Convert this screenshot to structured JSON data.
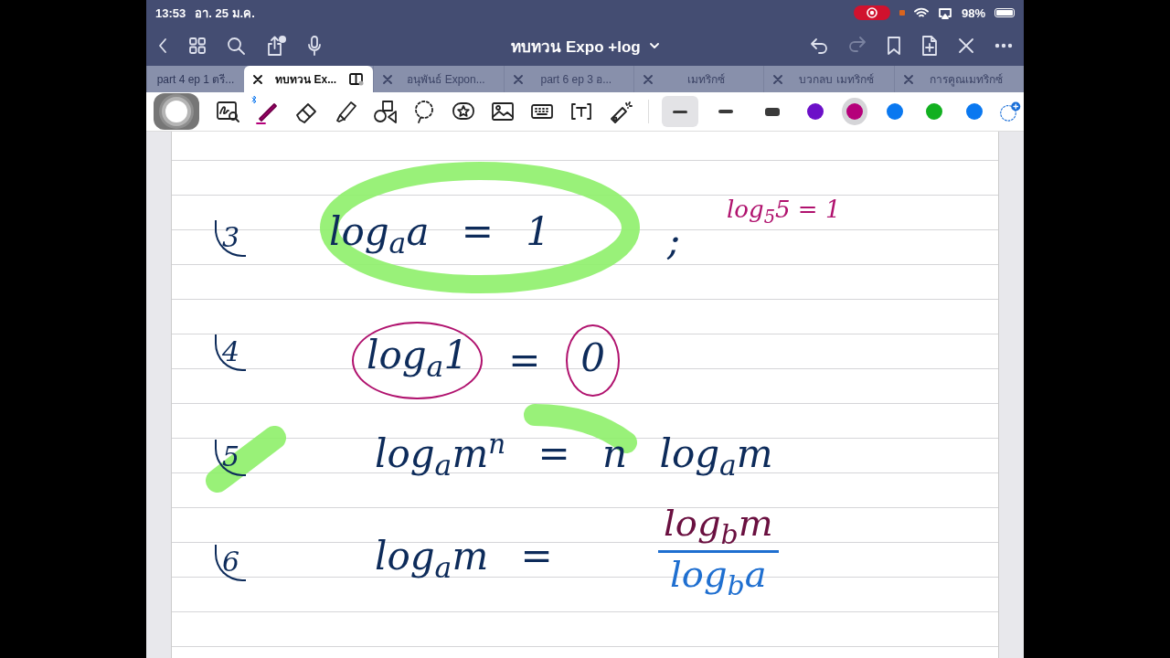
{
  "status_bar": {
    "time": "13:53",
    "date": "อา. 25 ม.ค.",
    "recording": true,
    "battery": "98%"
  },
  "document": {
    "title": "ทบทวน Expo +log"
  },
  "tabs": [
    {
      "label": "part 4 ep 1 ตรี...",
      "selected": false
    },
    {
      "label": "ทบทวน Ex...",
      "selected": true
    },
    {
      "label": "อนุพันธ์ Expon...",
      "selected": false
    },
    {
      "label": "part 6 ep 3 อ...",
      "selected": false
    },
    {
      "label": "เมทริกซ์",
      "selected": false
    },
    {
      "label": "บวกลบ เมทริกซ์",
      "selected": false
    },
    {
      "label": "การคูณเมทริกซ์",
      "selected": false
    }
  ],
  "tools": [
    {
      "kind": "zoom",
      "selected": false
    },
    {
      "kind": "pen",
      "selected": true
    },
    {
      "kind": "eraser",
      "selected": false
    },
    {
      "kind": "highlighter",
      "selected": false
    },
    {
      "kind": "shapes",
      "selected": false
    },
    {
      "kind": "lasso",
      "selected": false
    },
    {
      "kind": "sticker",
      "selected": false
    },
    {
      "kind": "image",
      "selected": false
    },
    {
      "kind": "keyboard",
      "selected": false
    },
    {
      "kind": "text",
      "selected": false
    },
    {
      "kind": "laser",
      "selected": false
    }
  ],
  "strokes": [
    {
      "selected": true
    },
    {
      "selected": false
    },
    {
      "selected": false
    }
  ],
  "colors": [
    {
      "color": "#6c10c8",
      "selected": false
    },
    {
      "color": "#b5007a",
      "selected": true
    },
    {
      "color": "#0a78f0",
      "selected": false
    },
    {
      "color": "#12b020",
      "selected": false
    },
    {
      "color": "#0a78f0",
      "selected": false
    }
  ],
  "notes": [
    {
      "number": "3",
      "formula": "log$_{a}$a = 1",
      "aside": ";",
      "side_note": "log$_{5}$5 = 1"
    },
    {
      "number": "4",
      "parts": [
        {
          "text": "log$_{a}$1",
          "circled": true
        },
        {
          "text": "=",
          "circled": false
        },
        {
          "text": "0",
          "circled": true
        }
      ]
    },
    {
      "number": "5",
      "formula": "log$_{a}$m$^{n}$ = n log$_{a}$m"
    },
    {
      "number": "6",
      "formula": "log$_{a}$m =",
      "numerator": "log$_{b}$m",
      "denominator": "log$_{b}$a"
    }
  ]
}
